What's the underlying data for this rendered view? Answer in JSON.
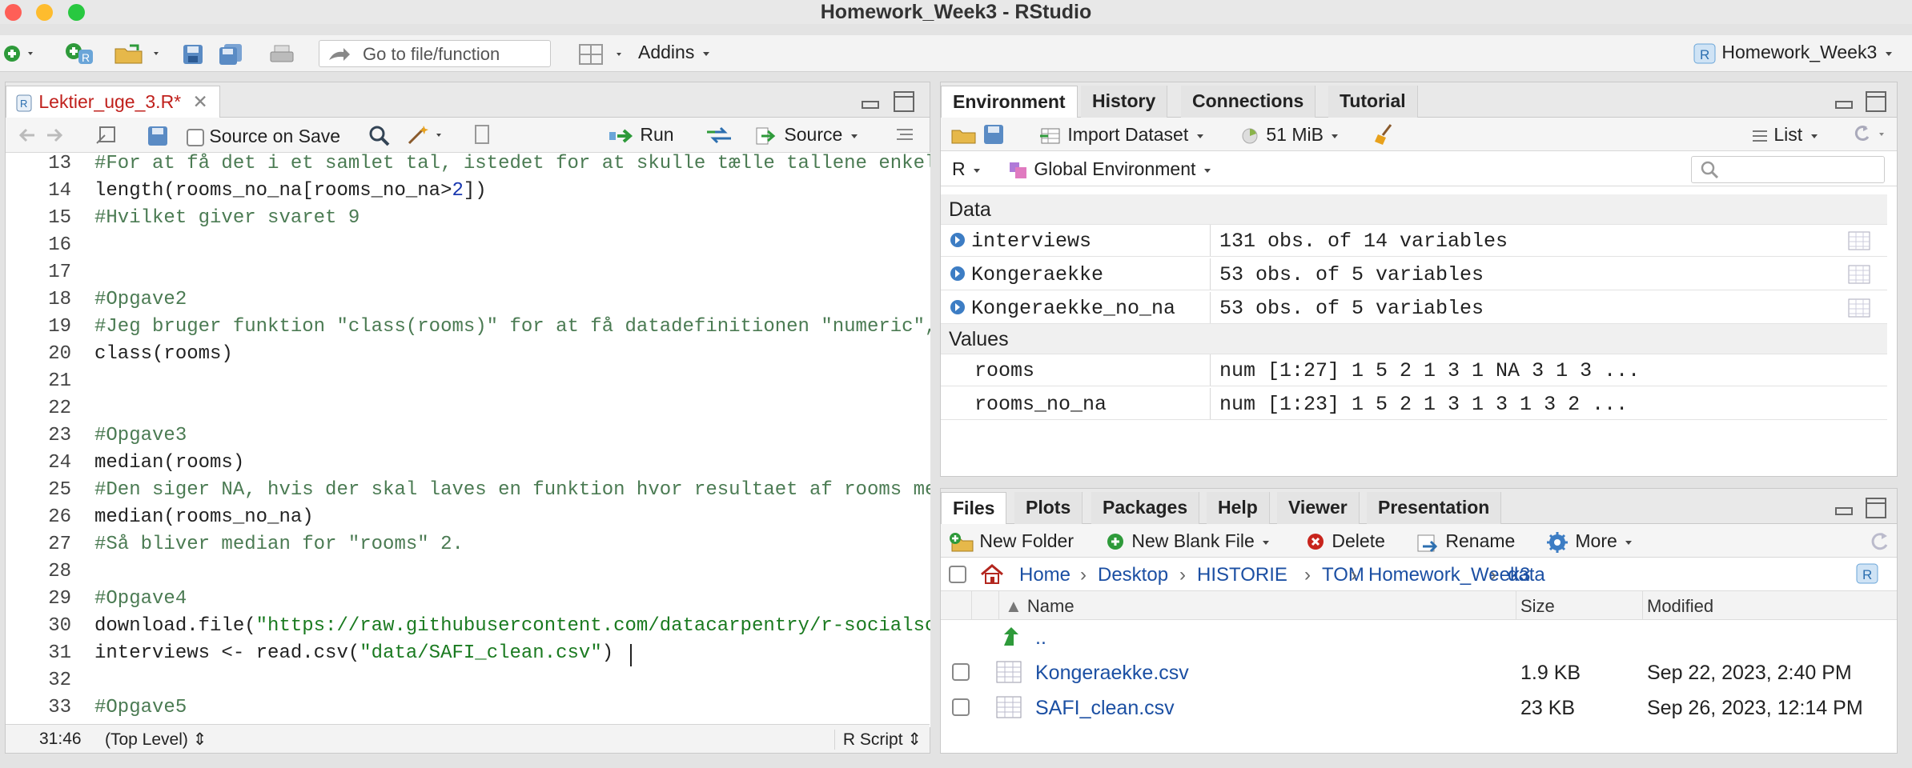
{
  "window": {
    "title": "Homework_Week3 - RStudio"
  },
  "toolbar": {
    "goto_placeholder": "Go to file/function",
    "addins_label": "Addins",
    "project_label": "Homework_Week3"
  },
  "editor": {
    "tab_label": "Lektier_uge_3.R*",
    "source_on_save": "Source on Save",
    "run_label": "Run",
    "source_label": "Source",
    "lines": [
      {
        "n": "13",
        "parts": [
          {
            "t": "#For at få det i et samlet tal, istedet for at skulle tælle tallene enkel",
            "c": "cm"
          }
        ]
      },
      {
        "n": "14",
        "parts": [
          {
            "t": "length(rooms_no_na[rooms_no_na>",
            "c": ""
          },
          {
            "t": "2",
            "c": "num"
          },
          {
            "t": "])",
            "c": ""
          }
        ]
      },
      {
        "n": "15",
        "parts": [
          {
            "t": "#Hvilket giver svaret 9",
            "c": "cm"
          }
        ]
      },
      {
        "n": "16",
        "parts": []
      },
      {
        "n": "17",
        "parts": []
      },
      {
        "n": "18",
        "parts": [
          {
            "t": "#Opgave2",
            "c": "cm"
          }
        ]
      },
      {
        "n": "19",
        "parts": [
          {
            "t": "#Jeg bruger funktion \"class(rooms)\" for at få datadefinitionen \"numeric\",",
            "c": "cm"
          }
        ]
      },
      {
        "n": "20",
        "parts": [
          {
            "t": "class(rooms)",
            "c": ""
          }
        ]
      },
      {
        "n": "21",
        "parts": []
      },
      {
        "n": "22",
        "parts": []
      },
      {
        "n": "23",
        "parts": [
          {
            "t": "#Opgave3",
            "c": "cm"
          }
        ]
      },
      {
        "n": "24",
        "parts": [
          {
            "t": "median(rooms)",
            "c": ""
          }
        ]
      },
      {
        "n": "25",
        "parts": [
          {
            "t": "#Den siger NA, hvis der skal laves en funktion hvor resultaet af rooms me",
            "c": "cm"
          }
        ]
      },
      {
        "n": "26",
        "parts": [
          {
            "t": "median(rooms_no_na)",
            "c": ""
          }
        ]
      },
      {
        "n": "27",
        "parts": [
          {
            "t": "#Så bliver median for \"rooms\" 2.",
            "c": "cm"
          }
        ]
      },
      {
        "n": "28",
        "parts": []
      },
      {
        "n": "29",
        "parts": [
          {
            "t": "#Opgave4",
            "c": "cm"
          }
        ]
      },
      {
        "n": "30",
        "parts": [
          {
            "t": "download.file(",
            "c": ""
          },
          {
            "t": "\"https://raw.githubusercontent.com/datacarpentry/r-socialsc",
            "c": "str"
          }
        ]
      },
      {
        "n": "31",
        "parts": [
          {
            "t": "interviews <- read.csv(",
            "c": ""
          },
          {
            "t": "\"data/SAFI_clean.csv\"",
            "c": "str"
          },
          {
            "t": ")",
            "c": ""
          }
        ]
      },
      {
        "n": "32",
        "parts": []
      },
      {
        "n": "33",
        "parts": [
          {
            "t": "#Opgave5",
            "c": "cm"
          }
        ]
      }
    ],
    "status_position": "31:46",
    "status_scope": "(Top Level)",
    "status_type": "R Script"
  },
  "env": {
    "tabs": [
      "Environment",
      "History",
      "Connections",
      "Tutorial"
    ],
    "import_label": "Import Dataset",
    "memory_label": "51 MiB",
    "list_label": "List",
    "r_label": "R",
    "scope_label": "Global Environment",
    "data_header": "Data",
    "values_header": "Values",
    "data_rows": [
      {
        "name": "interviews",
        "value": "131 obs. of 14 variables"
      },
      {
        "name": "Kongeraekke",
        "value": "53 obs. of 5 variables"
      },
      {
        "name": "Kongeraekke_no_na",
        "value": "53 obs. of 5 variables"
      }
    ],
    "value_rows": [
      {
        "name": "rooms",
        "value": "num [1:27] 1 5 2 1 3 1 NA 3 1 3 ..."
      },
      {
        "name": "rooms_no_na",
        "value": "num [1:23] 1 5 2 1 3 1 3 1 3 2 ..."
      }
    ]
  },
  "files": {
    "tabs": [
      "Files",
      "Plots",
      "Packages",
      "Help",
      "Viewer",
      "Presentation"
    ],
    "new_folder": "New Folder",
    "new_blank_file": "New Blank File",
    "delete": "Delete",
    "rename": "Rename",
    "more": "More",
    "breadcrumb": [
      "Home",
      "Desktop",
      "HISTORIE",
      "TOM",
      "Homework_Week3",
      "data"
    ],
    "col_name": "Name",
    "col_size": "Size",
    "col_modified": "Modified",
    "up_label": "..",
    "rows": [
      {
        "name": "Kongeraekke.csv",
        "size": "1.9 KB",
        "modified": "Sep 22, 2023, 2:40 PM"
      },
      {
        "name": "SAFI_clean.csv",
        "size": "23 KB",
        "modified": "Sep 26, 2023, 12:14 PM"
      }
    ]
  }
}
